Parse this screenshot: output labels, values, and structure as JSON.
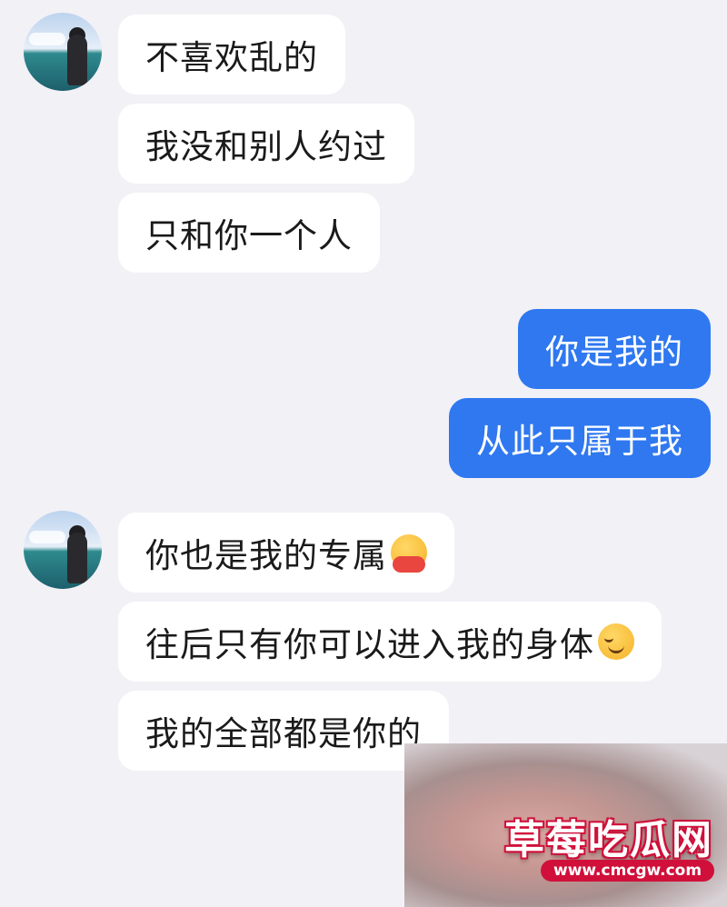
{
  "group1": {
    "messages": [
      "不喜欢乱的",
      "我没和别人约过",
      "只和你一个人"
    ]
  },
  "group2": {
    "messages": [
      "你是我的",
      "从此只属于我"
    ]
  },
  "group3": {
    "messages": [
      {
        "text": "你也是我的专属",
        "emoji": "hugging-face-icon"
      },
      {
        "text": "往后只有你可以进入我的身体",
        "emoji": "smiling-face-icon"
      },
      {
        "text": "我的全部都是你的"
      }
    ]
  },
  "watermark": {
    "title": "草莓吃瓜网",
    "url": "www.cmcgw.com"
  }
}
